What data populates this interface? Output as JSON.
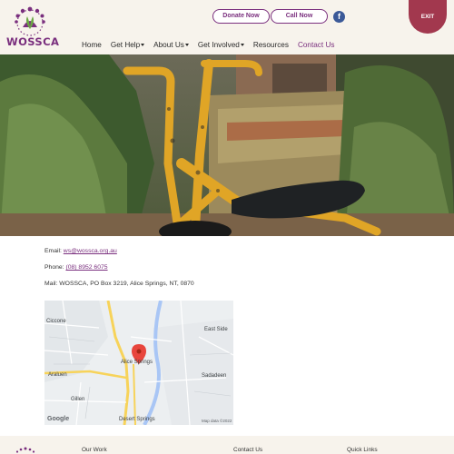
{
  "brand": {
    "name": "WOSSCA",
    "accent": "#7a2f7e",
    "exit_color": "#a2384e"
  },
  "header": {
    "donate_label": "Donate Now",
    "call_label": "Call Now",
    "social_icon": "facebook-icon",
    "exit_label": "EXIT"
  },
  "nav": {
    "items": [
      {
        "label": "Home"
      },
      {
        "label": "Get Help"
      },
      {
        "label": "About Us"
      },
      {
        "label": "Get Involved"
      },
      {
        "label": "Resources"
      },
      {
        "label": "Contact Us"
      }
    ]
  },
  "contact": {
    "email_label": "Email:",
    "email": "ws@wossca.org.au",
    "phone_label": "Phone:",
    "phone": "(08) 8952 6075",
    "mail_label": "Mail:",
    "mail": "WOSSCA, PO Box 3219, Alice Springs, NT, 0870"
  },
  "map": {
    "labels": [
      "Ciccone",
      "East Side",
      "Alice Springs",
      "Araluen",
      "Sadadeen",
      "Gillen",
      "Desert Springs"
    ],
    "attribution": "Google",
    "map_data": "Map data ©2022"
  },
  "footer": {
    "our_work": "Our Work",
    "contact_us": "Contact Us",
    "quick_links": "Quick Links"
  }
}
